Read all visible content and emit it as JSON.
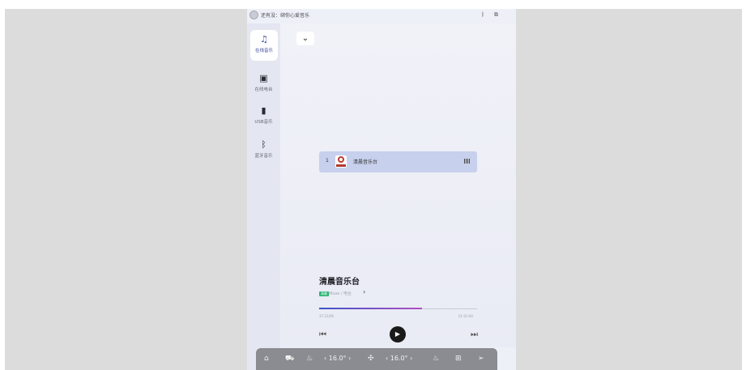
{
  "status_bar": {
    "greeting": "还有没：绑你心爱音乐",
    "bluetooth_icon": "bluetooth-icon",
    "screen_icon": "screen-mirror-icon"
  },
  "sidebar": {
    "items": [
      {
        "label": "在线音乐",
        "icon": "music-note-icon",
        "active": true
      },
      {
        "label": "在线电台",
        "icon": "radio-icon",
        "active": false
      },
      {
        "label": "USB音乐",
        "icon": "usb-icon",
        "active": false
      },
      {
        "label": "蓝牙音乐",
        "icon": "bluetooth-icon",
        "active": false
      }
    ]
  },
  "main": {
    "collapse_icon": "chevron-down-icon",
    "playlist": [
      {
        "index": "1",
        "title": "清晨音乐台",
        "playing": true
      }
    ],
    "now_playing": {
      "title": "清晨音乐台",
      "tag": "清晨",
      "subtitle": "Muse / 电台",
      "chevron": "›",
      "progress": 0.65,
      "time_elapsed": "37:21/06",
      "time_total": "01:01:00"
    },
    "controls": {
      "prev_icon": "skip-previous-icon",
      "play_icon": "play-icon",
      "next_icon": "skip-next-icon"
    }
  },
  "dock": {
    "home_icon": "home-icon",
    "car_icon": "car-icon",
    "seat_left_icon": "seat-heat-left-icon",
    "temp_left": "‹ 16.0° ›",
    "fan_icon": "fan-icon",
    "temp_right": "‹ 16.0° ›",
    "seat_right_icon": "seat-heat-right-icon",
    "apps_icon": "apps-grid-icon",
    "nav_icon": "navigation-icon"
  },
  "colors": {
    "accent": "#3b4a9a",
    "playlist_highlight": "#c7d0ec",
    "progress_start": "#3c55c8",
    "progress_end": "#b04fc0",
    "tag_green": "#2bb673"
  }
}
